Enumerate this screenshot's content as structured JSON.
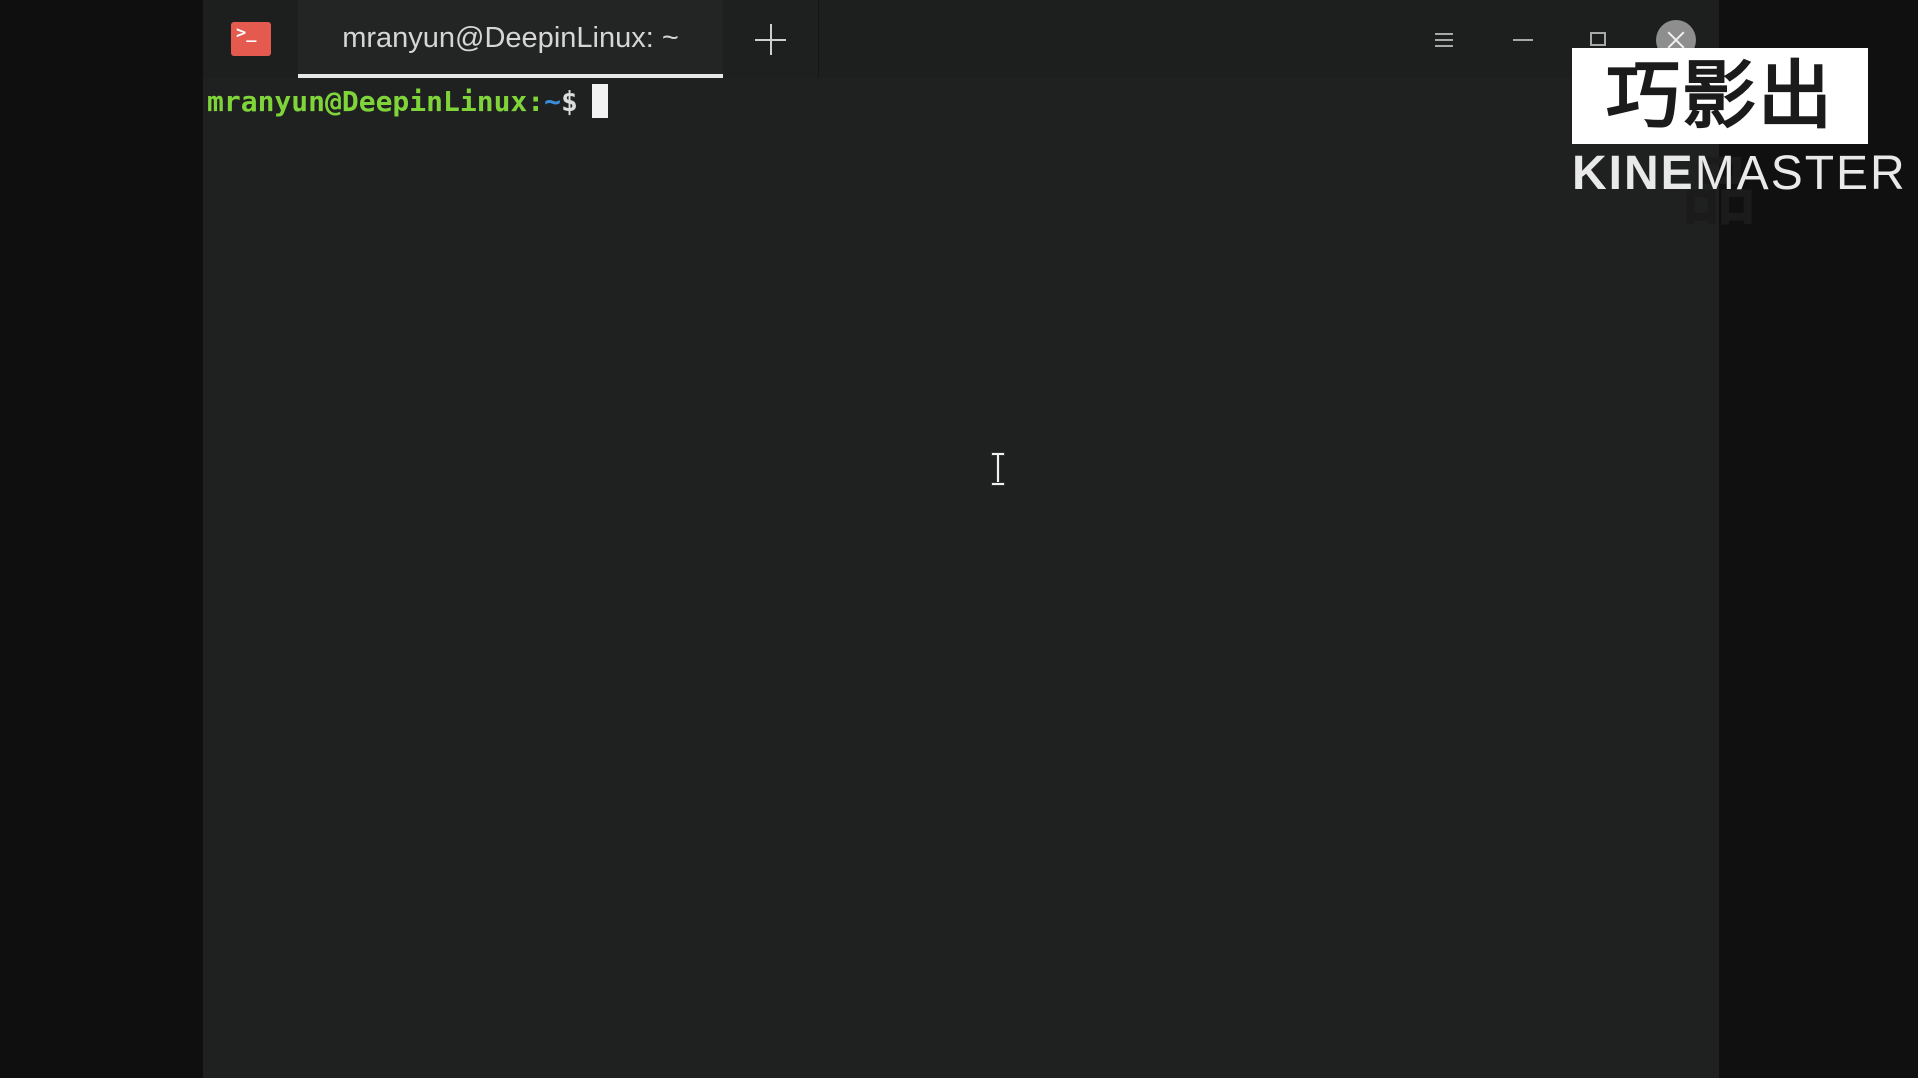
{
  "window": {
    "tab_title": "mranyun@DeepinLinux: ~",
    "app_icon_glyph": ">_",
    "app_icon_color": "#e45a4f",
    "controls": [
      "menu-icon",
      "minimize-icon",
      "maximize-icon",
      "close-icon"
    ]
  },
  "terminal": {
    "prompt_user_host": "mranyun@DeepinLinux:",
    "prompt_path": "~",
    "prompt_symbol": "$",
    "colors": {
      "user_host": "#7fd43a",
      "path": "#3b8edb",
      "background": "#1f2020"
    }
  },
  "watermark": {
    "chinese": "巧影出品",
    "brand_part1": "KINE",
    "brand_part2": "MASTER"
  }
}
